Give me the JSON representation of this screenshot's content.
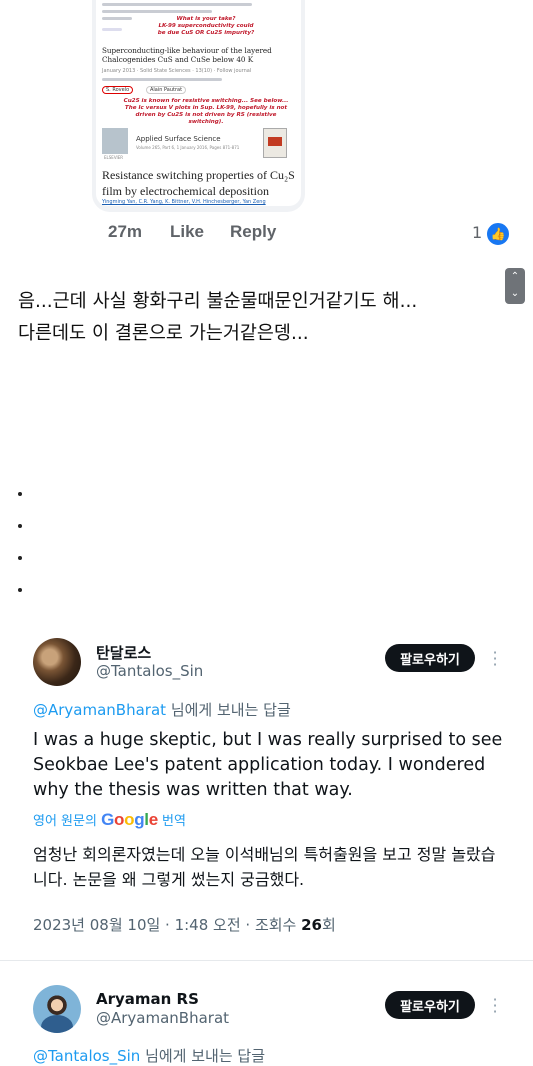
{
  "fb_comment": {
    "screenshot": {
      "lines_red": [
        "What is your take?",
        "LK-99 superconductivity could",
        "be due CuS OR Cu2S impurity?"
      ],
      "paper1_title": "Superconducting-like behaviour of the layered Chalcogenides CuS and CuSe below 40 K",
      "paper1_journal": "January 2013 · Solid State Sciences · 13(10) · Follow journal",
      "author_chips": [
        "S. Rovelo",
        "Alain Pautrat"
      ],
      "annotation_red": "Cu2S is known for resistive switching... See below... The Ic versus V plots in Sup. LK-99, hopefully is not driven by Cu2S is not driven by RS (resistive switching).",
      "journal_name": "Applied Surface Science",
      "journal_vol": "Volume 265, Part 6, 1 January 2016, Pages 871-871",
      "elsevier": "ELSEVIER",
      "paper2_title": "Resistance switching properties of Cu₂S film by electrochemical deposition",
      "paper2_authors": "Yingming Yan, C.R. Yang, K. Bittner, V.H. Hinchesberger, Yan Zeng"
    },
    "time": "27m",
    "like": "Like",
    "reply": "Reply",
    "like_count": "1"
  },
  "post": {
    "text": "음...근데 사실 황화구리 불순물때문인거같기도 해...\n다른데도 이 결론으로 가는거같은뎅...",
    "dots": [
      ".",
      ".",
      ".",
      "."
    ]
  },
  "tweets": [
    {
      "name": "탄달로스",
      "handle": "@Tantalos_Sin",
      "follow": "팔로우하기",
      "reply_to": "@AryamanBharat",
      "reply_suffix": " 님에게 보내는 답글",
      "body": "I was a huge skeptic, but I was really surprised to see Seokbae Lee's patent application today. I wondered why the thesis was written that way.",
      "translate_prefix": "영어 원문의 ",
      "translate_brand": "Google",
      "translate_suffix": " 번역",
      "translated": "엄청난 회의론자였는데 오늘 이석배님의 특허출원을 보고 정말 놀랐습니다. 논문을 왜 그렇게 썼는지 궁금했다.",
      "meta": "2023년 08월 10일 · 1:48 오전 · 조회수 ",
      "views": "26",
      "views_suffix": "회"
    },
    {
      "name": "Aryaman RS",
      "handle": "@AryamanBharat",
      "follow": "팔로우하기",
      "reply_to": "@Tantalos_Sin",
      "reply_suffix": " 님에게 보내는 답글"
    }
  ],
  "colors": {
    "fb_like_blue": "#1877f2",
    "twitter_blue": "#1d9bf0",
    "follow_bg": "#0f1419"
  }
}
